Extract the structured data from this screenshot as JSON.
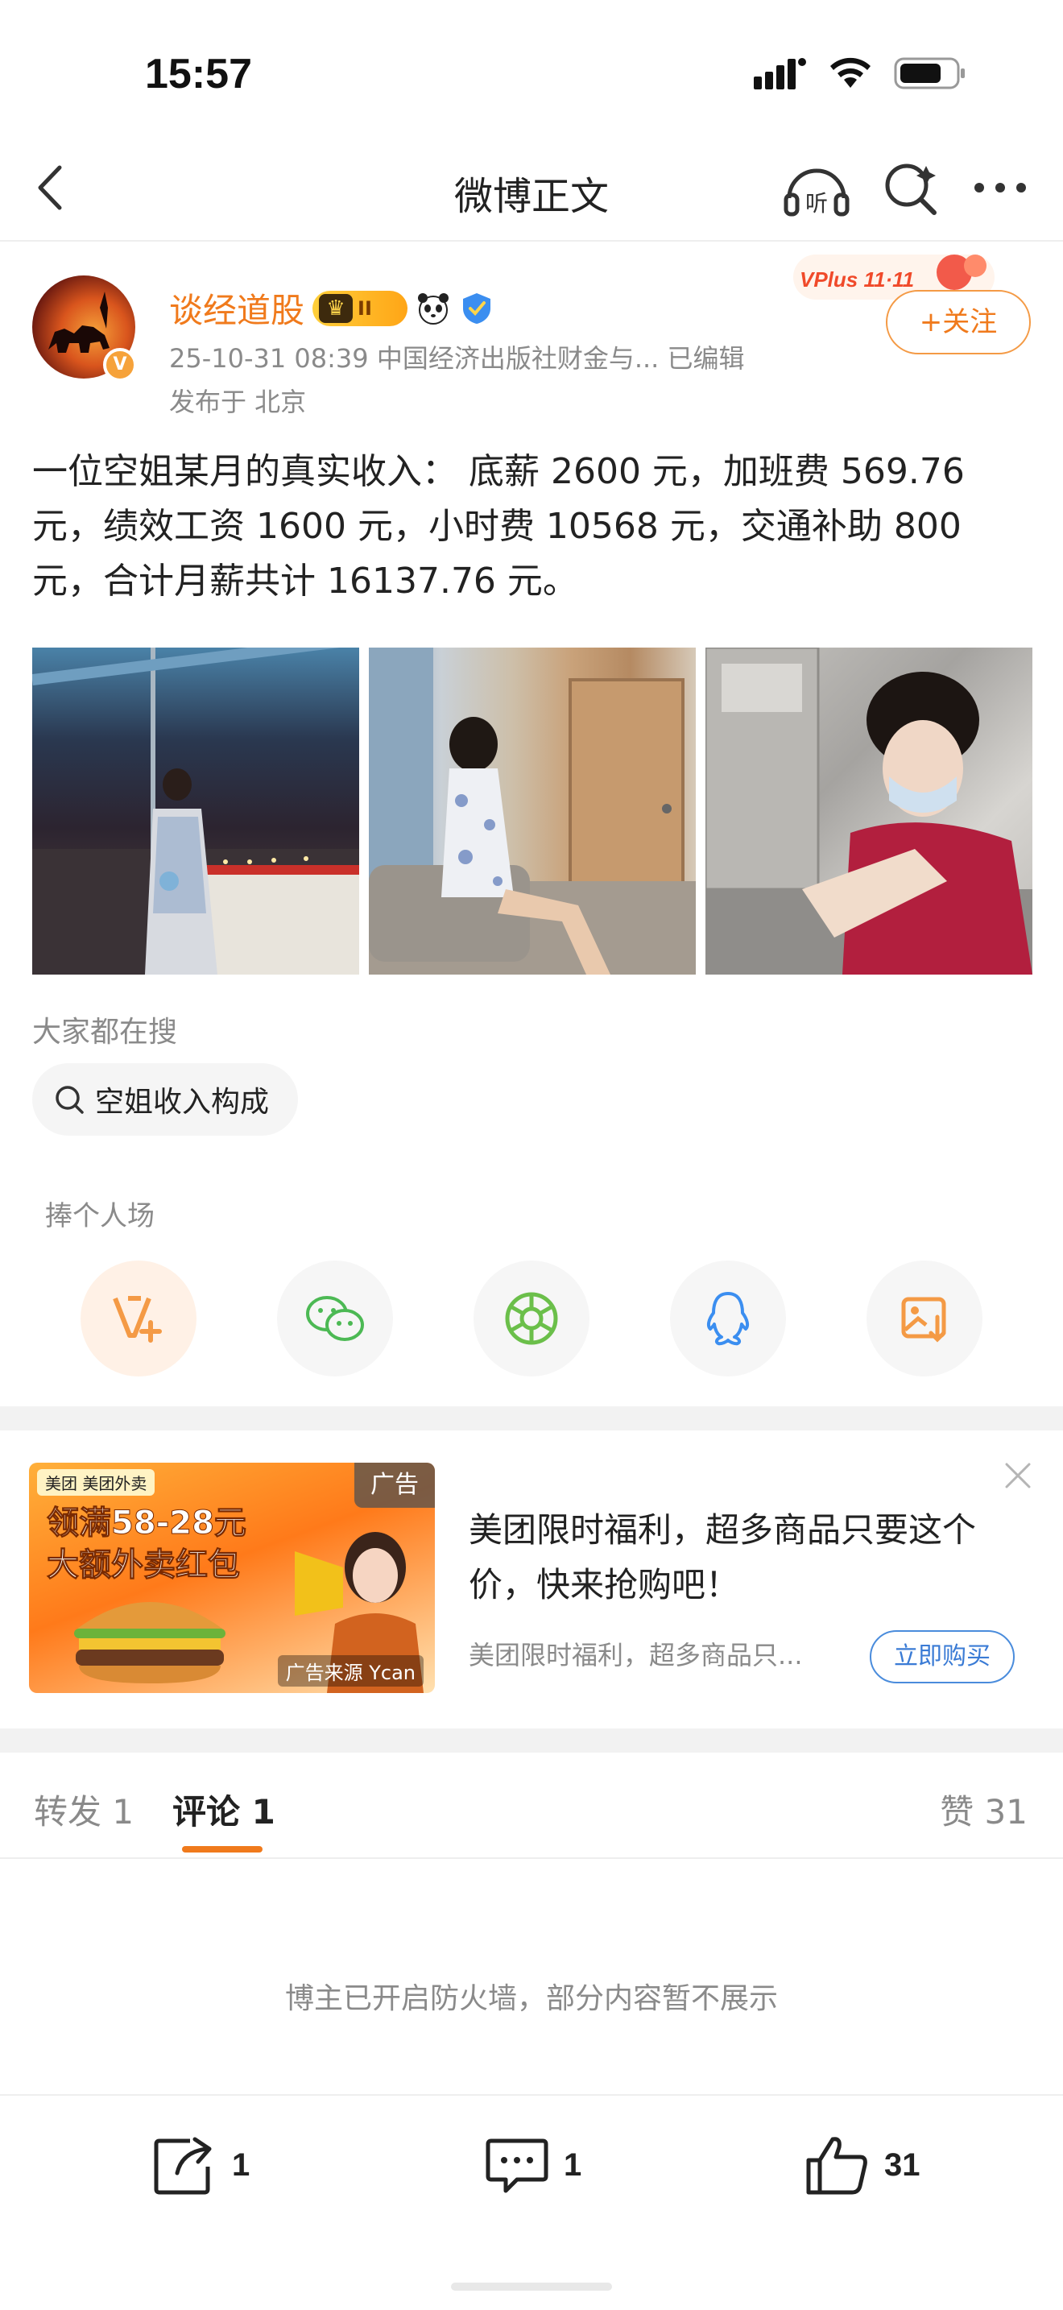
{
  "status_bar": {
    "time": "15:57"
  },
  "nav": {
    "title": "微博正文",
    "listen_label": "听"
  },
  "post": {
    "author": "谈经道股",
    "rank": "II",
    "meta": "25-10-31 08:39  中国经济出版社财金与...  已编辑",
    "location": "发布于 北京",
    "follow_label": "+关注",
    "vplus_label": "VPlus 11·11",
    "text": "一位空姐某月的真实收入： 底薪 2600 元，加班费 569.76 元，绩效工资 1600 元，小时费 10568 元，交通补助 800 元，合计月薪共计 16137.76 元。"
  },
  "hot_search": {
    "title": "大家都在搜",
    "chip": "空姐收入构成"
  },
  "share": {
    "title": "捧个人场",
    "items": [
      "vplus-icon",
      "wechat-icon",
      "moments-icon",
      "qq-icon",
      "save-image-icon"
    ]
  },
  "ad": {
    "brand": "美团 美团外卖",
    "headline1": "领满58-28元",
    "headline2": "大额外卖红包",
    "tag": "广告",
    "source": "广告来源 Ycan",
    "title": "美团限时福利，超多商品只要这个价，快来抢购吧！",
    "desc": "美团限时福利，超多商品只...",
    "button": "立即购买"
  },
  "tabs": {
    "repost": "转发 1",
    "comment": "评论 1",
    "likes": "赞 31"
  },
  "firewall_note": "博主已开启防火墙，部分内容暂不展示",
  "bottom_bar": {
    "repost_count": "1",
    "comment_count": "1",
    "like_count": "31"
  },
  "colors": {
    "accent": "#f07a1c",
    "link_blue": "#3a7bd5",
    "muted": "#8a8a8a"
  }
}
